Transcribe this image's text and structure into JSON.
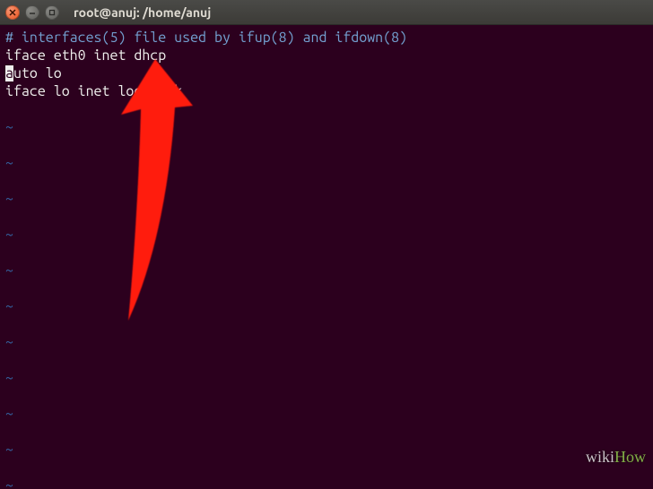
{
  "titlebar": {
    "title": "root@anuj: /home/anuj"
  },
  "terminal": {
    "line1_comment": "# interfaces(5) file used by ifup(8) and ifdown(8)",
    "line2": "iface eth0 inet dhcp",
    "line3_cursor_char": "a",
    "line3_rest": "uto lo",
    "line4": "iface lo inet loopback",
    "tilde": "~"
  },
  "watermark": {
    "wiki": "wiki",
    "how": "How"
  }
}
